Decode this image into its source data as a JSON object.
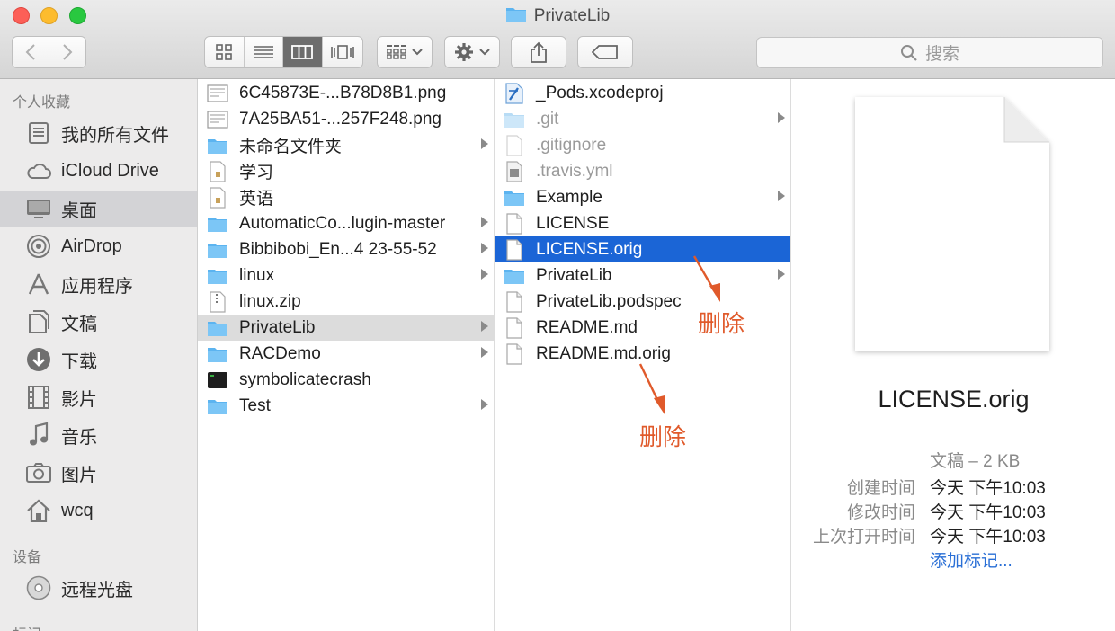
{
  "window": {
    "title": "PrivateLib",
    "search_placeholder": "搜索"
  },
  "toolbar": {
    "view_icons": [
      "icon-view-icon",
      "list-view-icon",
      "column-view-icon",
      "coverflow-view-icon"
    ],
    "active_view": "column-view-icon"
  },
  "sidebar": {
    "favorites_heading": "个人收藏",
    "favorites": [
      {
        "label": "我的所有文件",
        "icon": "all-files-icon"
      },
      {
        "label": "iCloud Drive",
        "icon": "cloud-icon"
      },
      {
        "label": "桌面",
        "icon": "desktop-icon",
        "selected": true
      },
      {
        "label": "AirDrop",
        "icon": "airdrop-icon"
      },
      {
        "label": "应用程序",
        "icon": "applications-icon"
      },
      {
        "label": "文稿",
        "icon": "documents-icon"
      },
      {
        "label": "下载",
        "icon": "download-icon"
      },
      {
        "label": "影片",
        "icon": "movies-icon"
      },
      {
        "label": "音乐",
        "icon": "music-icon"
      },
      {
        "label": "图片",
        "icon": "pictures-icon"
      },
      {
        "label": "wcq",
        "icon": "home-icon"
      }
    ],
    "devices_heading": "设备",
    "devices": [
      {
        "label": "远程光盘",
        "icon": "disc-icon"
      }
    ],
    "tags_heading": "标记"
  },
  "column1": [
    {
      "label": "6C45873E-...B78D8B1.png",
      "type": "image"
    },
    {
      "label": "7A25BA51-...257F248.png",
      "type": "image"
    },
    {
      "label": "未命名文件夹",
      "type": "folder",
      "chevron": true
    },
    {
      "label": "学习",
      "type": "doc"
    },
    {
      "label": "英语",
      "type": "doc"
    },
    {
      "label": "AutomaticCo...lugin-master",
      "type": "folder",
      "chevron": true
    },
    {
      "label": "Bibbibobi_En...4 23-55-52",
      "type": "folder",
      "chevron": true
    },
    {
      "label": "linux",
      "type": "folder",
      "chevron": true
    },
    {
      "label": "linux.zip",
      "type": "zip"
    },
    {
      "label": "PrivateLib",
      "type": "folder",
      "chevron": true,
      "selected": true
    },
    {
      "label": "RACDemo",
      "type": "folder",
      "chevron": true
    },
    {
      "label": "symbolicatecrash",
      "type": "exec"
    },
    {
      "label": "Test",
      "type": "folder",
      "chevron": true
    }
  ],
  "column2": [
    {
      "label": "_Pods.xcodeproj",
      "type": "xcode"
    },
    {
      "label": ".git",
      "type": "folder-dim",
      "chevron": true,
      "dim": true
    },
    {
      "label": ".gitignore",
      "type": "file-dim",
      "dim": true
    },
    {
      "label": ".travis.yml",
      "type": "yml",
      "dim": true
    },
    {
      "label": "Example",
      "type": "folder",
      "chevron": true
    },
    {
      "label": "LICENSE",
      "type": "file"
    },
    {
      "label": "LICENSE.orig",
      "type": "file",
      "selected": true
    },
    {
      "label": "PrivateLib",
      "type": "folder",
      "chevron": true
    },
    {
      "label": "PrivateLib.podspec",
      "type": "file"
    },
    {
      "label": "README.md",
      "type": "file"
    },
    {
      "label": "README.md.orig",
      "type": "file"
    }
  ],
  "preview": {
    "name": "LICENSE.orig",
    "kind_size": "文稿 – 2 KB",
    "created_label": "创建时间",
    "created_value": "今天 下午10:03",
    "modified_label": "修改时间",
    "modified_value": "今天 下午10:03",
    "opened_label": "上次打开时间",
    "opened_value": "今天 下午10:03",
    "add_tags": "添加标记..."
  },
  "annotations": {
    "delete_1": "删除",
    "delete_2": "删除",
    "color": "#e05a2b"
  }
}
